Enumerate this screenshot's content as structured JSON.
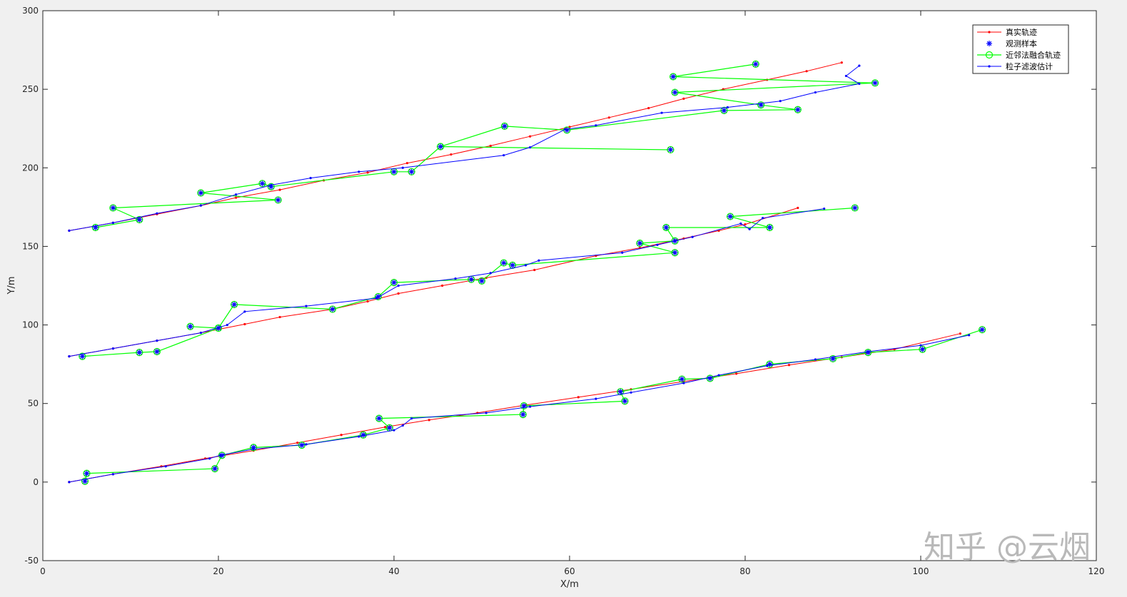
{
  "chart_data": {
    "type": "line",
    "xlabel": "X/m",
    "ylabel": "Y/m",
    "xlim": [
      0,
      120
    ],
    "ylim": [
      -50,
      300
    ],
    "xticks": [
      0,
      20,
      40,
      60,
      80,
      100,
      120
    ],
    "yticks": [
      -50,
      0,
      50,
      100,
      150,
      200,
      250,
      300
    ],
    "grid": false,
    "legend_position": "top-right",
    "legend": [
      {
        "label": "真实轨迹",
        "color": "#ff0000",
        "marker": "dot"
      },
      {
        "label": "观测样本",
        "color": "#0000ff",
        "marker": "asterisk"
      },
      {
        "label": "近邻法融合轨迹",
        "color": "#00ff00",
        "marker": "circle"
      },
      {
        "label": "粒子滤波估计",
        "color": "#0000ff",
        "marker": "dot"
      }
    ],
    "targets": [
      {
        "true": [
          [
            3,
            0
          ],
          [
            8,
            5
          ],
          [
            13.5,
            10
          ],
          [
            18.5,
            15
          ],
          [
            24,
            20
          ],
          [
            29,
            25
          ],
          [
            34,
            30
          ],
          [
            39,
            35
          ],
          [
            44,
            39.5
          ],
          [
            49.5,
            44
          ],
          [
            55,
            49
          ],
          [
            61,
            54
          ],
          [
            67,
            59
          ],
          [
            73,
            64
          ],
          [
            79,
            69
          ],
          [
            85,
            74.5
          ],
          [
            91,
            79.5
          ],
          [
            97,
            84.5
          ],
          [
            104.5,
            94.5
          ]
        ],
        "observations": [
          [
            4.8,
            0.5
          ],
          [
            5,
            5.5
          ],
          [
            19.6,
            8.5
          ],
          [
            20.4,
            17
          ],
          [
            24,
            22
          ],
          [
            29.5,
            23.5
          ],
          [
            36.5,
            30
          ],
          [
            39.5,
            34.5
          ],
          [
            38.3,
            40.5
          ],
          [
            54.7,
            43
          ],
          [
            54.8,
            48.5
          ],
          [
            66.3,
            51.5
          ],
          [
            65.8,
            57.5
          ],
          [
            72.8,
            65.5
          ],
          [
            76,
            66
          ],
          [
            82.8,
            75
          ],
          [
            90,
            78.5
          ],
          [
            94,
            82.5
          ],
          [
            100.2,
            84.5
          ],
          [
            107,
            97
          ]
        ],
        "fused": [
          [
            4.8,
            0.5
          ],
          [
            5,
            5.5
          ],
          [
            19.6,
            8.5
          ],
          [
            20.4,
            17
          ],
          [
            24,
            22
          ],
          [
            29.5,
            23.5
          ],
          [
            36.5,
            30
          ],
          [
            39.5,
            34.5
          ],
          [
            38.3,
            40.5
          ],
          [
            54.7,
            43
          ],
          [
            54.8,
            48.5
          ],
          [
            66.3,
            51.5
          ],
          [
            65.8,
            57.5
          ],
          [
            72.8,
            65.5
          ],
          [
            76,
            66
          ],
          [
            82.8,
            75
          ],
          [
            90,
            78.5
          ],
          [
            94,
            82.5
          ],
          [
            100.2,
            84.5
          ],
          [
            107,
            97
          ]
        ],
        "estimate": [
          [
            3,
            0
          ],
          [
            8,
            5
          ],
          [
            14,
            10
          ],
          [
            19,
            15
          ],
          [
            20.2,
            17
          ],
          [
            24,
            21
          ],
          [
            30,
            24
          ],
          [
            36,
            29
          ],
          [
            40,
            33
          ],
          [
            41,
            36
          ],
          [
            42,
            40.5
          ],
          [
            50.5,
            44
          ],
          [
            55.5,
            48
          ],
          [
            63,
            53
          ],
          [
            67,
            57
          ],
          [
            73,
            63
          ],
          [
            77,
            68
          ],
          [
            82.5,
            74
          ],
          [
            88,
            78
          ],
          [
            94,
            83
          ],
          [
            100,
            87
          ],
          [
            105.5,
            93.5
          ]
        ]
      },
      {
        "true": [
          [
            3,
            80
          ],
          [
            8,
            85
          ],
          [
            13,
            90
          ],
          [
            18,
            95
          ],
          [
            23,
            100.5
          ],
          [
            27,
            105
          ],
          [
            33,
            110
          ],
          [
            37,
            115
          ],
          [
            40.5,
            120
          ],
          [
            45.5,
            125
          ],
          [
            50.5,
            130
          ],
          [
            56,
            135
          ],
          [
            63,
            144
          ],
          [
            68,
            149
          ],
          [
            73,
            155
          ],
          [
            77,
            160
          ],
          [
            80,
            164
          ],
          [
            86,
            174.5
          ]
        ],
        "observations": [
          [
            4.5,
            80
          ],
          [
            11,
            82.5
          ],
          [
            13,
            83
          ],
          [
            16.8,
            99
          ],
          [
            20,
            98
          ],
          [
            21.8,
            113
          ],
          [
            33,
            110
          ],
          [
            38.2,
            118
          ],
          [
            40,
            127
          ],
          [
            48.8,
            129
          ],
          [
            50,
            128
          ],
          [
            52.5,
            139.5
          ],
          [
            53.5,
            138
          ],
          [
            68,
            152
          ],
          [
            72,
            146
          ],
          [
            71,
            162
          ],
          [
            72,
            153.5
          ],
          [
            78.3,
            169
          ],
          [
            82.8,
            162
          ],
          [
            92.5,
            174.5
          ]
        ],
        "fused": [
          [
            4.5,
            80
          ],
          [
            11,
            82.5
          ],
          [
            13,
            83
          ],
          [
            20,
            98
          ],
          [
            16.8,
            99
          ],
          [
            20,
            98
          ],
          [
            21.8,
            113
          ],
          [
            33,
            110
          ],
          [
            38.2,
            118
          ],
          [
            40,
            127
          ],
          [
            48.8,
            129
          ],
          [
            50,
            128
          ],
          [
            52.5,
            139.5
          ],
          [
            53.5,
            138
          ],
          [
            72,
            146
          ],
          [
            68,
            152
          ],
          [
            72,
            153.5
          ],
          [
            71,
            162
          ],
          [
            82.8,
            162
          ],
          [
            78.3,
            169
          ],
          [
            92.5,
            174.5
          ]
        ],
        "estimate": [
          [
            3,
            80
          ],
          [
            8,
            85
          ],
          [
            13,
            90
          ],
          [
            18,
            95
          ],
          [
            21,
            100
          ],
          [
            23,
            108.5
          ],
          [
            30,
            112
          ],
          [
            38,
            117
          ],
          [
            40.5,
            125
          ],
          [
            47,
            129.5
          ],
          [
            51,
            133
          ],
          [
            55,
            138
          ],
          [
            56.5,
            141
          ],
          [
            66,
            146
          ],
          [
            70,
            151
          ],
          [
            74,
            156
          ],
          [
            79.5,
            164.5
          ],
          [
            80.5,
            161
          ],
          [
            82,
            168
          ],
          [
            89,
            174
          ]
        ]
      },
      {
        "true": [
          [
            3,
            160
          ],
          [
            8,
            165
          ],
          [
            13,
            170.5
          ],
          [
            18,
            176
          ],
          [
            22,
            181
          ],
          [
            27,
            186
          ],
          [
            32,
            192
          ],
          [
            37,
            197
          ],
          [
            41.5,
            203
          ],
          [
            46.5,
            208.5
          ],
          [
            51,
            214
          ],
          [
            55.5,
            220
          ],
          [
            60,
            226
          ],
          [
            64.5,
            232
          ],
          [
            69,
            238
          ],
          [
            73,
            244
          ],
          [
            77.5,
            250
          ],
          [
            82.5,
            256
          ],
          [
            87,
            261.5
          ],
          [
            91,
            267
          ]
        ],
        "observations": [
          [
            6,
            162
          ],
          [
            11,
            167
          ],
          [
            8,
            174.5
          ],
          [
            18,
            184
          ],
          [
            26.8,
            179.5
          ],
          [
            25,
            190
          ],
          [
            26,
            188
          ],
          [
            40,
            197.5
          ],
          [
            42,
            197.5
          ],
          [
            45.3,
            213.5
          ],
          [
            52.6,
            226.5
          ],
          [
            59.7,
            224
          ],
          [
            71.5,
            211.5
          ],
          [
            71.8,
            258
          ],
          [
            72,
            248
          ],
          [
            77.6,
            236.5
          ],
          [
            81.2,
            266
          ],
          [
            81.8,
            240
          ],
          [
            86,
            237
          ],
          [
            94.8,
            254
          ]
        ],
        "fused": [
          [
            6,
            162
          ],
          [
            11,
            167
          ],
          [
            8,
            174.5
          ],
          [
            26.8,
            179.5
          ],
          [
            18,
            184
          ],
          [
            25,
            190
          ],
          [
            26,
            188
          ],
          [
            40,
            197.5
          ],
          [
            42,
            197.5
          ],
          [
            45.3,
            213.5
          ],
          [
            71.5,
            211.5
          ],
          [
            45.3,
            213.5
          ],
          [
            52.6,
            226.5
          ],
          [
            59.7,
            224
          ],
          [
            77.6,
            236.5
          ],
          [
            86,
            237
          ],
          [
            81.8,
            240
          ],
          [
            72,
            248
          ],
          [
            94.8,
            254
          ],
          [
            71.8,
            258
          ],
          [
            81.2,
            266
          ]
        ],
        "estimate": [
          [
            3,
            160
          ],
          [
            8,
            165
          ],
          [
            13,
            171
          ],
          [
            18,
            176
          ],
          [
            22,
            183
          ],
          [
            26,
            189
          ],
          [
            30.5,
            193.5
          ],
          [
            36,
            197.5
          ],
          [
            41,
            200
          ],
          [
            52.5,
            208
          ],
          [
            55.5,
            213
          ],
          [
            59.5,
            224.5
          ],
          [
            63,
            227
          ],
          [
            70.5,
            235
          ],
          [
            78,
            238.5
          ],
          [
            84,
            242.5
          ],
          [
            88,
            248
          ],
          [
            93,
            253.5
          ],
          [
            91.5,
            258.5
          ],
          [
            93,
            265
          ]
        ]
      }
    ]
  },
  "watermark": "知乎 @云烟"
}
